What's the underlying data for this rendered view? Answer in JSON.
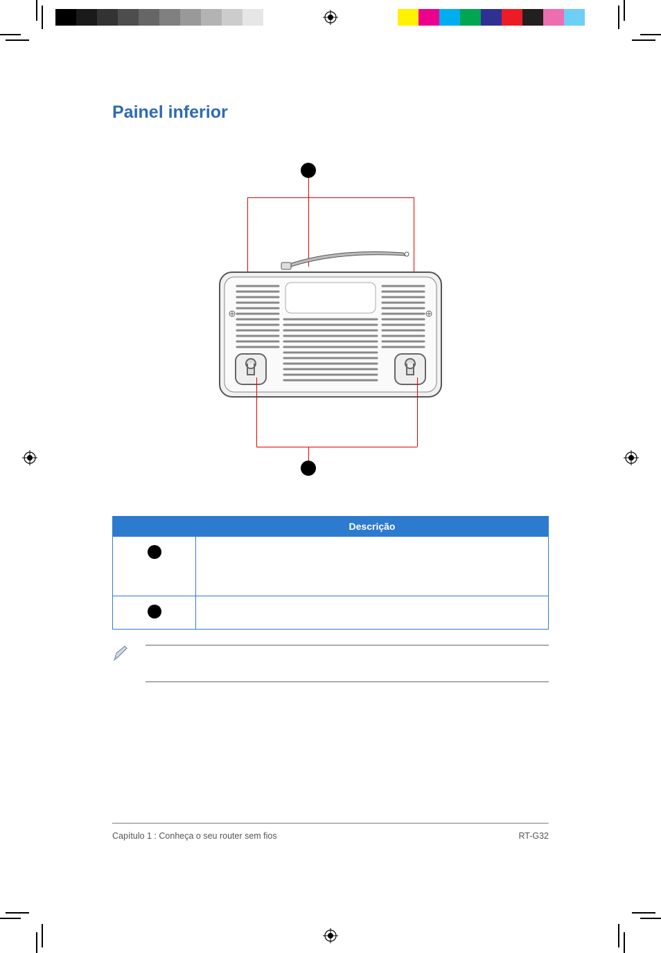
{
  "heading": "Painel inferior",
  "table": {
    "header_item": "",
    "header_desc": "Descrição"
  },
  "footer": {
    "left": "Capítulo 1 : Conheça o seu router sem fios",
    "right": "RT-G32"
  },
  "marks": {
    "grays": [
      "#000000",
      "#1a1a1a",
      "#333333",
      "#4d4d4d",
      "#666666",
      "#808080",
      "#999999",
      "#b3b3b3",
      "#cccccc",
      "#e6e6e6",
      "#ffffff"
    ],
    "colors": [
      "#fff200",
      "#ec008c",
      "#00aeef",
      "#00a651",
      "#2e3192",
      "#ed1c24",
      "#231f20",
      "#ec6eb0",
      "#6dcff6",
      "#ffffff"
    ]
  }
}
